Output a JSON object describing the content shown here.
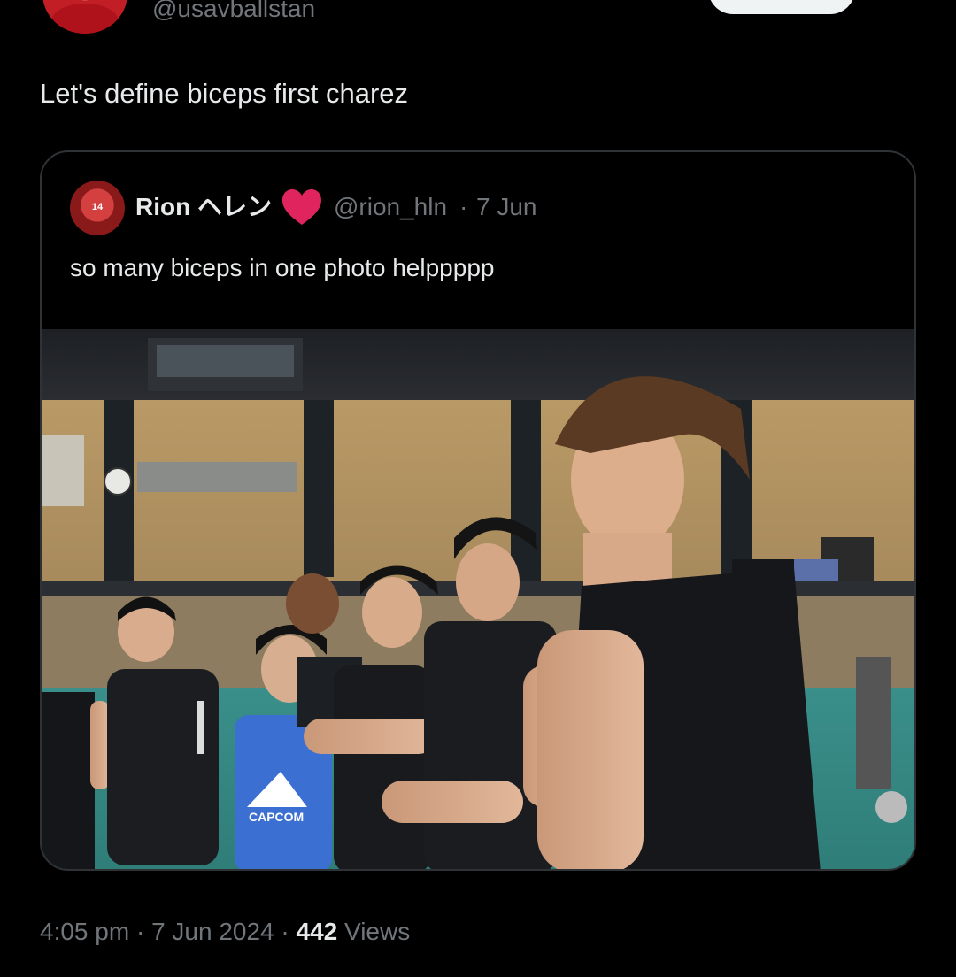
{
  "author": {
    "handle": "@usavballstan"
  },
  "tweet": {
    "text": "Let's define biceps first charez"
  },
  "quote": {
    "name": "Rion ヘレン",
    "avatar_number": "14",
    "handle": "@rion_hln",
    "separator": "·",
    "date": "7 Jun",
    "text": "so many biceps in one photo helppppp",
    "heart_color": "#e0245e"
  },
  "meta": {
    "time": "4:05 pm",
    "separator": "·",
    "date": "7 Jun 2024",
    "separator2": "·",
    "views_count": "442",
    "views_label": "Views"
  },
  "colors": {
    "background": "#000000",
    "text_primary": "#e7e9ea",
    "text_secondary": "#71767b",
    "border": "#2f3336"
  },
  "photo": {
    "jersey_text": "CAPCOM"
  }
}
